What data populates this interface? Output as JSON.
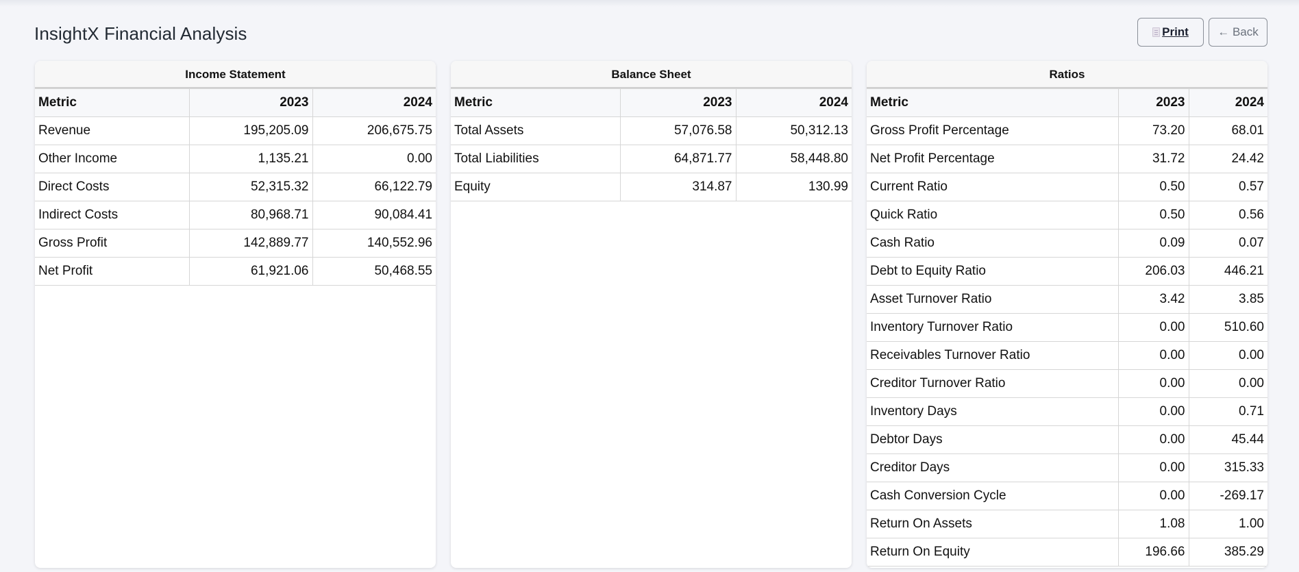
{
  "app_title": "InsightX Financial Analysis",
  "actions": {
    "print_label": "Print",
    "back_label": "← Back"
  },
  "columns": [
    "Metric",
    "2023",
    "2024"
  ],
  "income_statement": {
    "title": "Income Statement",
    "rows": [
      [
        "Revenue",
        "195,205.09",
        "206,675.75"
      ],
      [
        "Other Income",
        "1,135.21",
        "0.00"
      ],
      [
        "Direct Costs",
        "52,315.32",
        "66,122.79"
      ],
      [
        "Indirect Costs",
        "80,968.71",
        "90,084.41"
      ],
      [
        "Gross Profit",
        "142,889.77",
        "140,552.96"
      ],
      [
        "Net Profit",
        "61,921.06",
        "50,468.55"
      ]
    ]
  },
  "balance_sheet": {
    "title": "Balance Sheet",
    "rows": [
      [
        "Total Assets",
        "57,076.58",
        "50,312.13"
      ],
      [
        "Total Liabilities",
        "64,871.77",
        "58,448.80"
      ],
      [
        "Equity",
        "314.87",
        "130.99"
      ]
    ]
  },
  "ratios": {
    "title": "Ratios",
    "rows": [
      [
        "Gross Profit Percentage",
        "73.20",
        "68.01"
      ],
      [
        "Net Profit Percentage",
        "31.72",
        "24.42"
      ],
      [
        "Current Ratio",
        "0.50",
        "0.57"
      ],
      [
        "Quick Ratio",
        "0.50",
        "0.56"
      ],
      [
        "Cash Ratio",
        "0.09",
        "0.07"
      ],
      [
        "Debt to Equity Ratio",
        "206.03",
        "446.21"
      ],
      [
        "Asset Turnover Ratio",
        "3.42",
        "3.85"
      ],
      [
        "Inventory Turnover Ratio",
        "0.00",
        "510.60"
      ],
      [
        "Receivables Turnover Ratio",
        "0.00",
        "0.00"
      ],
      [
        "Creditor Turnover Ratio",
        "0.00",
        "0.00"
      ],
      [
        "Inventory Days",
        "0.00",
        "0.71"
      ],
      [
        "Debtor Days",
        "0.00",
        "45.44"
      ],
      [
        "Creditor Days",
        "0.00",
        "315.33"
      ],
      [
        "Cash Conversion Cycle",
        "0.00",
        "-269.17"
      ],
      [
        "Return On Assets",
        "1.08",
        "1.00"
      ],
      [
        "Return On Equity",
        "196.66",
        "385.29"
      ]
    ]
  },
  "icons": {
    "print": "document-icon"
  }
}
